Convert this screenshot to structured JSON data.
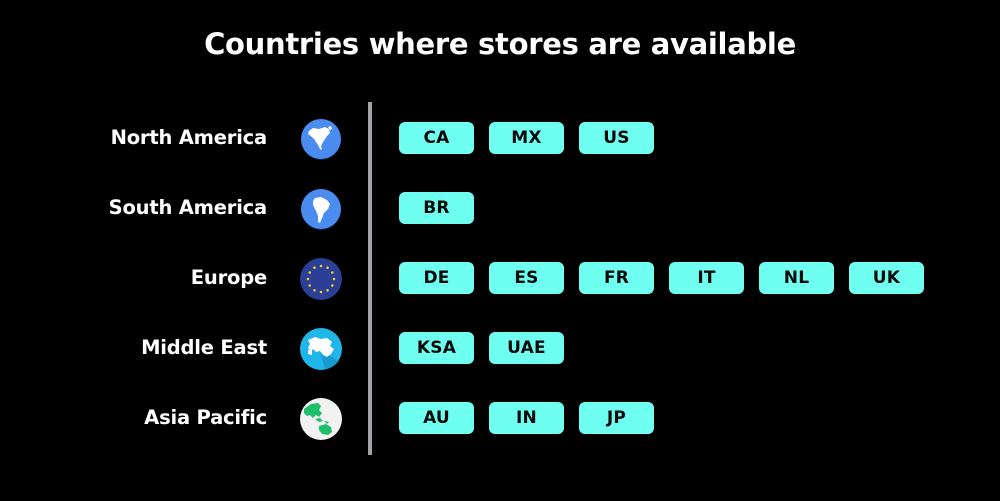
{
  "title": "Countries where stores are available",
  "colors": {
    "background": "#000000",
    "pill": "#6ffff0",
    "pill_text": "#0a0a0a",
    "divider": "#a3a3a7",
    "text": "#ffffff"
  },
  "regions": [
    {
      "name": "North America",
      "icon": "north-america-globe-icon",
      "countries": [
        "CA",
        "MX",
        "US"
      ]
    },
    {
      "name": "South America",
      "icon": "south-america-globe-icon",
      "countries": [
        "BR"
      ]
    },
    {
      "name": "Europe",
      "icon": "eu-flag-icon",
      "countries": [
        "DE",
        "ES",
        "FR",
        "IT",
        "NL",
        "UK"
      ]
    },
    {
      "name": "Middle East",
      "icon": "middle-east-map-icon",
      "countries": [
        "KSA",
        "UAE"
      ]
    },
    {
      "name": "Asia Pacific",
      "icon": "asia-pacific-globe-icon",
      "countries": [
        "AU",
        "IN",
        "JP"
      ]
    }
  ]
}
